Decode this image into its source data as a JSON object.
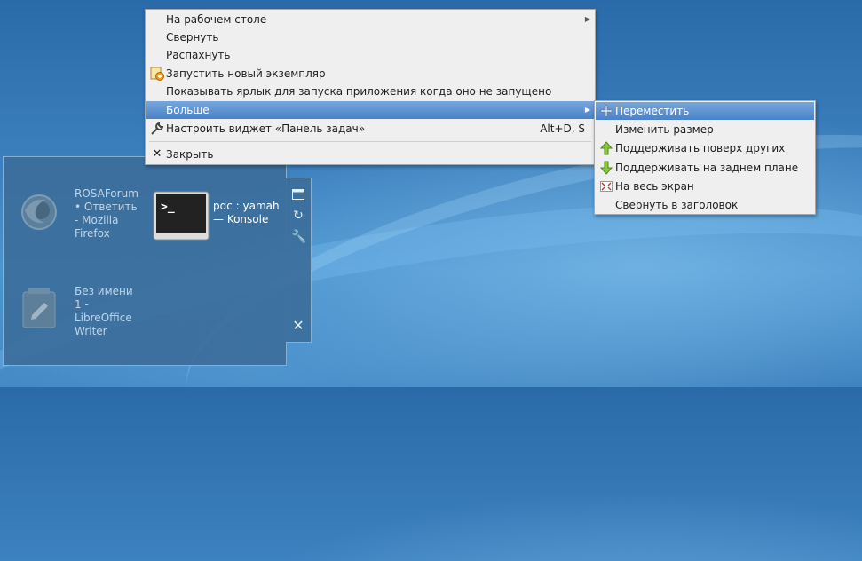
{
  "main_menu": {
    "items": [
      {
        "label": "На рабочем столе",
        "has_submenu": true
      },
      {
        "label": "Свернуть"
      },
      {
        "label": "Распахнуть"
      },
      {
        "label": "Запустить новый экземпляр",
        "icon": "launch-icon"
      },
      {
        "label": "Показывать ярлык для запуска приложения когда оно не запущено"
      },
      {
        "label": "Больше",
        "has_submenu": true,
        "highlighted": true
      },
      {
        "label": "Настроить виджет «Панель задач»",
        "shortcut": "Alt+D, S",
        "icon": "wrench-icon"
      },
      {
        "label": "Закрыть",
        "icon": "close-icon"
      }
    ]
  },
  "sub_menu": {
    "items": [
      {
        "label": "Переместить",
        "icon": "move-icon",
        "highlighted": true
      },
      {
        "label": "Изменить размер"
      },
      {
        "label": "Поддерживать поверх других",
        "icon": "arrow-up-icon"
      },
      {
        "label": "Поддерживать на заднем плане",
        "icon": "arrow-down-icon"
      },
      {
        "label": "На весь экран",
        "icon": "fullscreen-icon"
      },
      {
        "label": "Свернуть в заголовок"
      }
    ]
  },
  "switcher": {
    "windows": [
      {
        "title": "ROSAForum • Ответить - Mozilla Firefox",
        "lines": [
          "ROSAForum",
          "• Ответить",
          "- Mozilla",
          "Firefox"
        ],
        "icon": "firefox-icon"
      },
      {
        "title": "pdc : yamah — Konsole",
        "lines": [
          "pdc : yamah",
          "— Konsole"
        ],
        "icon": "terminal-icon"
      },
      {
        "title": "Без имени 1 - LibreOffice Writer",
        "lines": [
          "Без имени",
          "1 -",
          "LibreOffice",
          "Writer"
        ],
        "icon": "writer-icon"
      }
    ],
    "tools": [
      "window-icon",
      "refresh-icon",
      "wrench-icon",
      "close-icon"
    ]
  },
  "colors": {
    "highlight": "#4a82c8",
    "menu_bg": "#efefef",
    "desktop": "#3d82c0"
  }
}
